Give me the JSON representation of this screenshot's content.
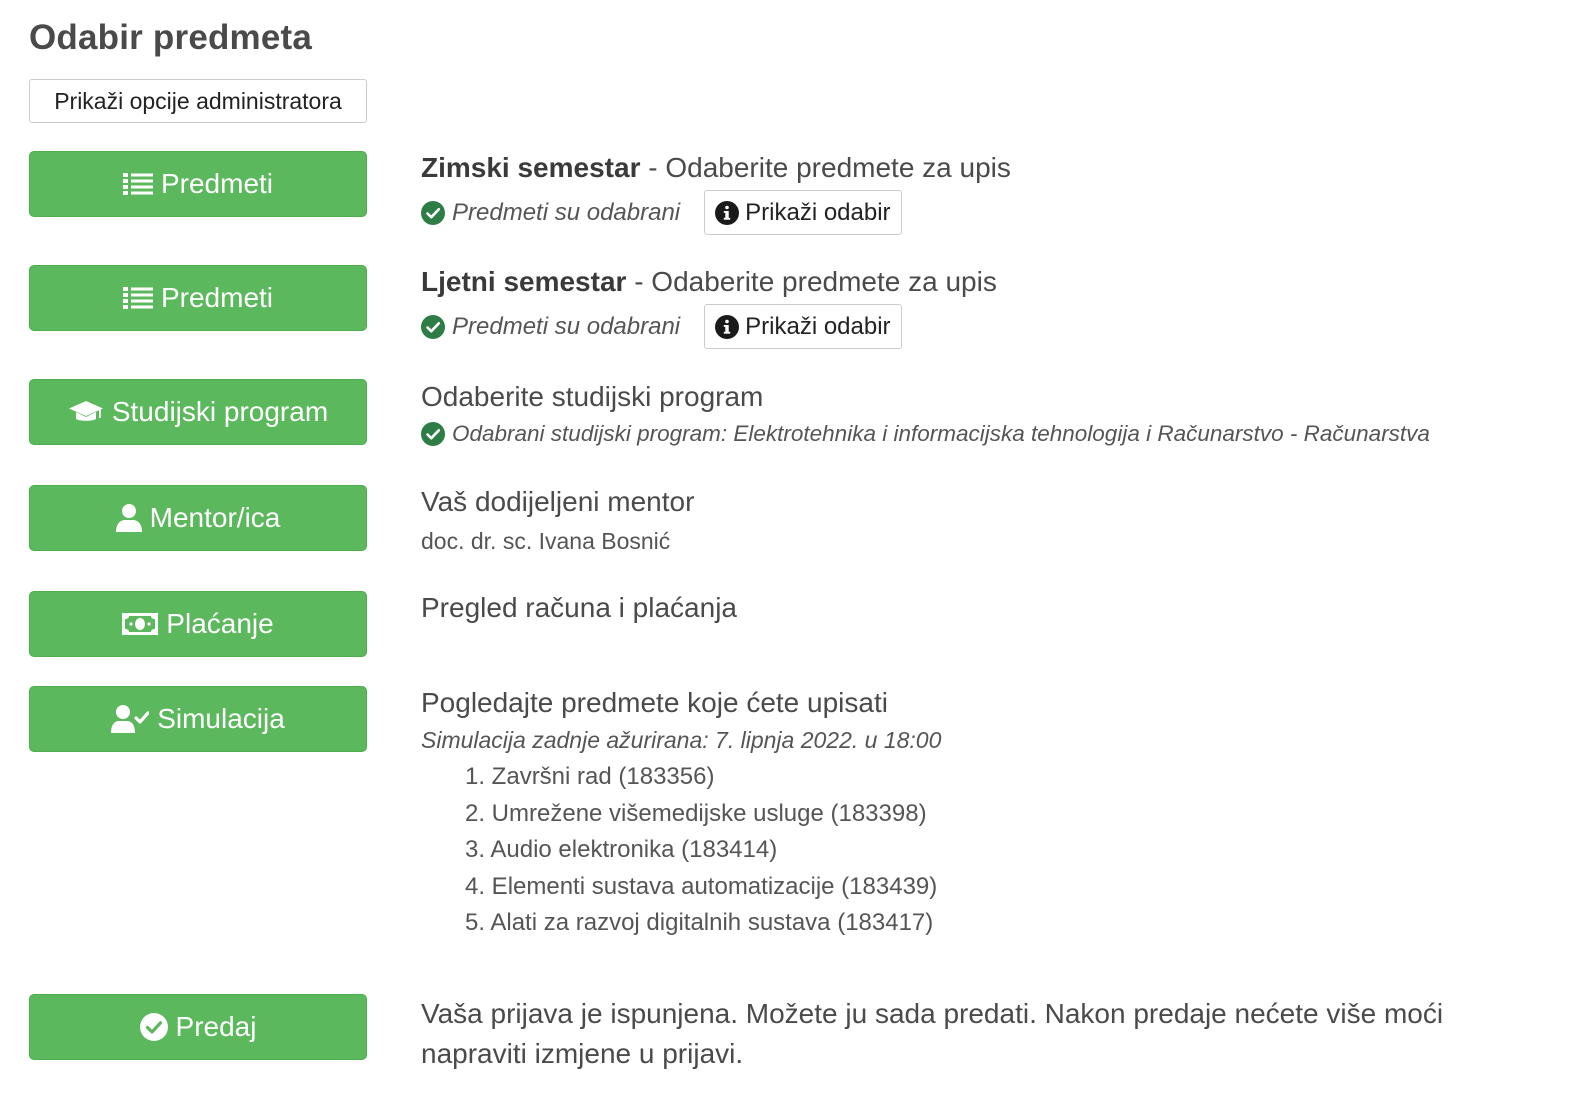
{
  "page_title": "Odabir predmeta",
  "admin_button_label": "Prikaži opcije administratora",
  "winter": {
    "button_label": "Predmeti",
    "title_bold": "Zimski semestar",
    "title_rest": " - Odaberite predmete za upis",
    "status": "Predmeti su odabrani",
    "show_label": "Prikaži odabir"
  },
  "summer": {
    "button_label": "Predmeti",
    "title_bold": "Ljetni semestar",
    "title_rest": " - Odaberite predmete za upis",
    "status": "Predmeti su odabrani",
    "show_label": "Prikaži odabir"
  },
  "program": {
    "button_label": "Studijski program",
    "title": "Odaberite studijski program",
    "status": "Odabrani studijski program: Elektrotehnika i informacijska tehnologija i Računarstvo - Računarstva"
  },
  "mentor": {
    "button_label": "Mentor/ica",
    "title": "Vaš dodijeljeni mentor",
    "name": "doc. dr. sc. Ivana Bosnić"
  },
  "payment": {
    "button_label": "Plaćanje",
    "title": "Pregled računa i plaćanja"
  },
  "simulation": {
    "button_label": "Simulacija",
    "title": "Pogledajte predmete koje ćete upisati",
    "updated": "Simulacija zadnje ažurirana: 7. lipnja 2022. u 18:00",
    "items": [
      "1. Završni rad (183356)",
      "2. Umrežene višemedijske usluge (183398)",
      "3. Audio elektronika (183414)",
      "4. Elementi sustava automatizacije (183439)",
      "5. Alati za razvoj digitalnih sustava (183417)"
    ]
  },
  "submit": {
    "button_label": "Predaj",
    "text": "Vaša prijava je ispunjena. Možete ju sada predati. Nakon predaje nećete više moći napraviti izmjene u prijavi."
  },
  "colors": {
    "button_green": "#5cb85c",
    "check_green": "#2e7d46",
    "text": "#444444"
  },
  "icons": {
    "predmeti": "list-icon",
    "program": "graduation-cap-icon",
    "mentor": "user-icon",
    "payment": "money-bill-icon",
    "simulation": "user-check-icon",
    "submit": "check-circle-icon",
    "status": "check-circle-icon",
    "info": "info-circle-icon"
  }
}
